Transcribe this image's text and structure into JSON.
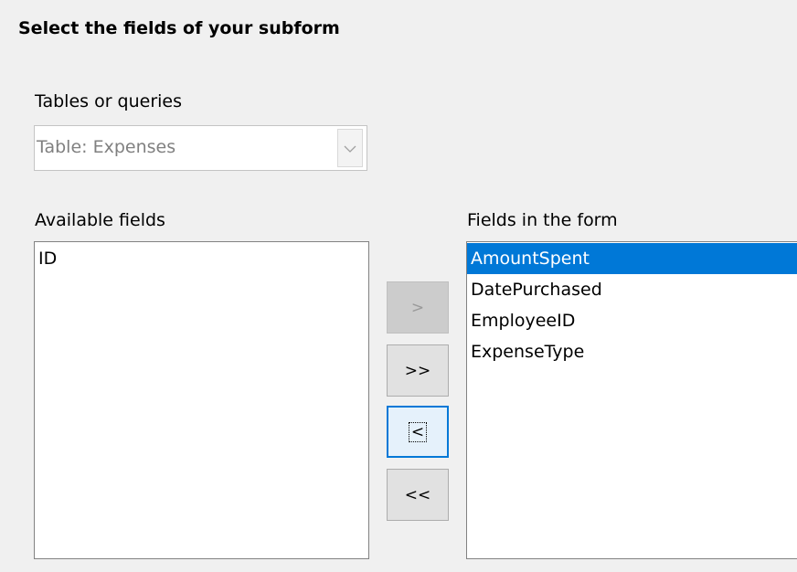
{
  "header": {
    "title": "Select the fields of your subform"
  },
  "tables": {
    "label": "Tables or queries",
    "selected": "Table: Expenses"
  },
  "available": {
    "label": "Available fields",
    "items": [
      "ID"
    ]
  },
  "in_form": {
    "label": "Fields in the form",
    "items": [
      "AmountSpent",
      "DatePurchased",
      "EmployeeID",
      "ExpenseType"
    ],
    "selected_index": 0
  },
  "buttons": {
    "add": ">",
    "add_all": ">>",
    "remove": "<",
    "remove_all": "<<"
  },
  "colors": {
    "selection": "#0078d7",
    "background": "#f0f0f0"
  },
  "icons": {
    "dropdown": "chevron-down-icon"
  }
}
